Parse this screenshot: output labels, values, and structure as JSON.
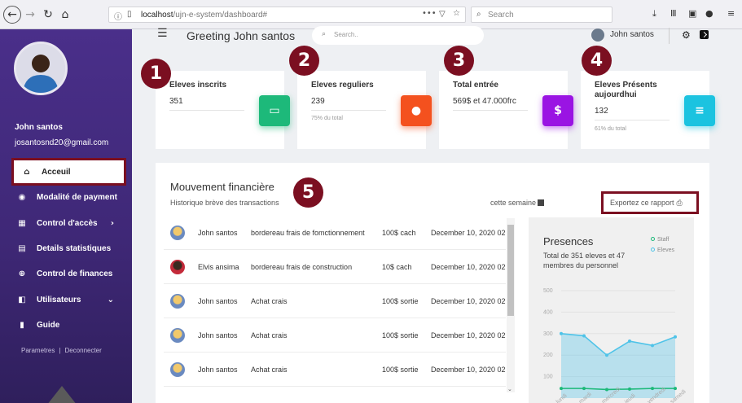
{
  "browser": {
    "url_host": "localhost",
    "url_path": "/ujn-e-system/dashboard#",
    "search_placeholder": "Search"
  },
  "sidebar": {
    "user_name": "John santos",
    "user_email": "josantosnd20@gmail.com",
    "items": [
      {
        "label": "Acceuil",
        "icon": "home-icon",
        "active": true
      },
      {
        "label": "Modalité de payment",
        "icon": "payment-icon"
      },
      {
        "label": "Control d'accès",
        "icon": "grid-icon",
        "has_chevron": "right"
      },
      {
        "label": "Details statistiques",
        "icon": "table-icon"
      },
      {
        "label": "Control de finances",
        "icon": "finance-icon"
      },
      {
        "label": "Utilisateurs",
        "icon": "users-icon",
        "has_chevron": "down"
      },
      {
        "label": "Guide",
        "icon": "document-icon"
      }
    ],
    "links": [
      "Parametres",
      "Deconnecter"
    ]
  },
  "topbar": {
    "greeting": "Greeting John santos",
    "search_placeholder": "Search..",
    "user_name": "John santos"
  },
  "badges": [
    "1",
    "2",
    "3",
    "4",
    "5"
  ],
  "stats": [
    {
      "title": "Eleves inscrits",
      "value": "351",
      "sub": "",
      "icon": "card-icon",
      "color": "#1db97a"
    },
    {
      "title": "Eleves reguliers",
      "value": "239",
      "sub": "75% du total",
      "icon": "user-icon",
      "color": "#f4511e"
    },
    {
      "title": "Total entrée",
      "value": "569$ et 47.000frc",
      "sub": "",
      "icon": "dollar-icon",
      "color": "#9a14e3"
    },
    {
      "title": "Eleves Présents aujourdhui",
      "value": "132",
      "sub": "61% du total",
      "icon": "document-icon",
      "color": "#1bc3e0"
    }
  ],
  "finance": {
    "title": "Mouvement financière",
    "subtitle": "Historique brève des transactions",
    "week_filter": "cette semaine",
    "export_label": "Exportez ce rapport",
    "transactions": [
      {
        "name": "John santos",
        "desc": "bordereau frais de fomctionnement",
        "amount": "100$ cach",
        "date": "December 10, 2020 02"
      },
      {
        "name": "Elvis ansima",
        "desc": "bordereau frais de construction",
        "amount": "10$ cach",
        "date": "December 10, 2020 02"
      },
      {
        "name": "John santos",
        "desc": "Achat crais",
        "amount": "100$ sortie",
        "date": "December 10, 2020 02"
      },
      {
        "name": "John santos",
        "desc": "Achat crais",
        "amount": "100$ sortie",
        "date": "December 10, 2020 02"
      },
      {
        "name": "John santos",
        "desc": "Achat crais",
        "amount": "100$ sortie",
        "date": "December 10, 2020 02"
      }
    ]
  },
  "presences": {
    "title": "Presences",
    "subtitle": "Total de 351 eleves et 47 membres du personnel",
    "legend": [
      {
        "label": "Staff",
        "color": "#1db97a"
      },
      {
        "label": "Eleves",
        "color": "#4fc3e8"
      }
    ]
  },
  "chart_data": {
    "type": "area",
    "categories": [
      "lundi",
      "mardi",
      "mercredi",
      "jeudi",
      "vendredi",
      "samedi"
    ],
    "yticks": [
      100,
      200,
      300,
      400,
      500
    ],
    "ylim": [
      0,
      500
    ],
    "series": [
      {
        "name": "Eleves",
        "values": [
          300,
          290,
          200,
          265,
          245,
          285
        ],
        "color": "#4fc3e8"
      },
      {
        "name": "Staff",
        "values": [
          45,
          45,
          40,
          42,
          45,
          45
        ],
        "color": "#1db97a"
      }
    ]
  }
}
